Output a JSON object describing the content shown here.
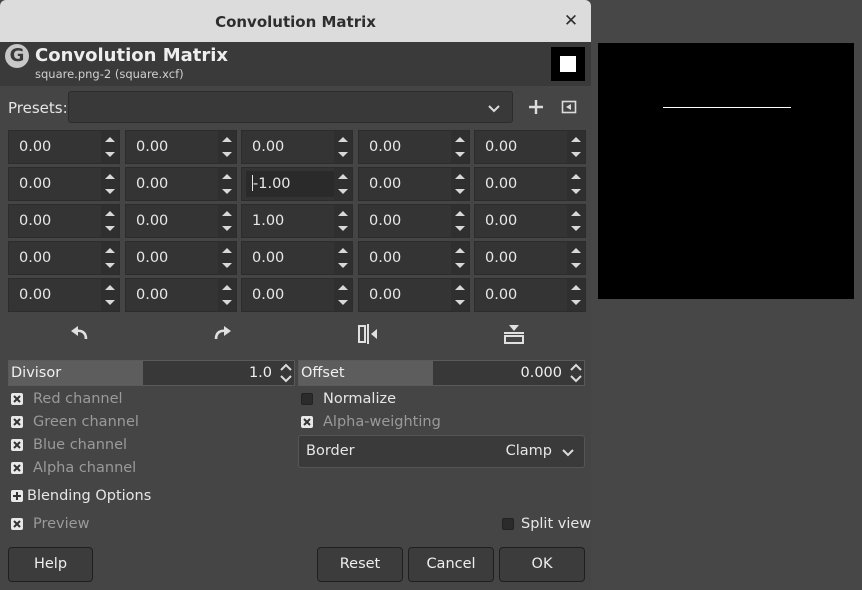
{
  "window": {
    "title": "Convolution Matrix",
    "close_glyph": "✕"
  },
  "header": {
    "title": "Convolution Matrix",
    "subtitle": "square.png-2 (square.xcf)",
    "logo_letter": "G"
  },
  "presets": {
    "label": "Presets:",
    "value": "",
    "add_icon": "plus-icon",
    "menu_icon": "menu-arrow-icon"
  },
  "matrix": {
    "rows": [
      [
        "0.00",
        "0.00",
        "0.00",
        "0.00",
        "0.00"
      ],
      [
        "0.00",
        "0.00",
        "-1.00",
        "0.00",
        "0.00"
      ],
      [
        "0.00",
        "0.00",
        "1.00",
        "0.00",
        "0.00"
      ],
      [
        "0.00",
        "0.00",
        "0.00",
        "0.00",
        "0.00"
      ],
      [
        "0.00",
        "0.00",
        "0.00",
        "0.00",
        "0.00"
      ]
    ],
    "focused_cell": [
      1,
      2
    ]
  },
  "tools": [
    "rotate-ccw-icon",
    "rotate-cw-icon",
    "flip-horizontal-icon",
    "flip-vertical-icon"
  ],
  "divisor": {
    "label": "Divisor",
    "value": "1.0"
  },
  "offset": {
    "label": "Offset",
    "value": "0.000"
  },
  "channels": {
    "red": {
      "label": "Red channel",
      "checked": true
    },
    "green": {
      "label": "Green channel",
      "checked": true
    },
    "blue": {
      "label": "Blue channel",
      "checked": true
    },
    "alpha": {
      "label": "Alpha channel",
      "checked": true
    }
  },
  "normalize": {
    "label": "Normalize",
    "checked": false
  },
  "alpha_weighting": {
    "label": "Alpha-weighting",
    "checked": true
  },
  "border": {
    "label": "Border",
    "value": "Clamp"
  },
  "blending": {
    "label": "Blending Options"
  },
  "preview": {
    "label": "Preview",
    "checked": true
  },
  "split_view": {
    "label": "Split view",
    "checked": false
  },
  "buttons": {
    "help": "Help",
    "reset": "Reset",
    "cancel": "Cancel",
    "ok": "OK"
  }
}
